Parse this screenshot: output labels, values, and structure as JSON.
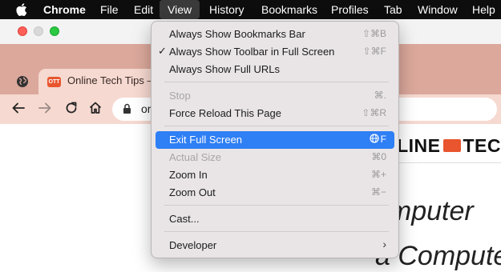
{
  "menubar": {
    "app_name": "Chrome",
    "items": [
      "File",
      "Edit",
      "View",
      "History",
      "Bookmarks",
      "Profiles",
      "Tab",
      "Window",
      "Help"
    ]
  },
  "browser": {
    "tab_title": "Online Tech Tips –",
    "favicon_text": "OTT",
    "url_partial": "or"
  },
  "page": {
    "logo_left": "NLINE",
    "logo_right": "TEC",
    "headline1": "omputer",
    "headline2": "a Compute"
  },
  "view_menu": {
    "items": [
      {
        "label": "Always Show Bookmarks Bar",
        "shortcut": "⇧⌘B"
      },
      {
        "label": "Always Show Toolbar in Full Screen",
        "shortcut": "⇧⌘F",
        "checked": true
      },
      {
        "label": "Always Show Full URLs",
        "shortcut": ""
      },
      {
        "label": "Stop",
        "shortcut": "⌘.",
        "disabled": true
      },
      {
        "label": "Force Reload This Page",
        "shortcut": "⇧⌘R"
      },
      {
        "label": "Exit Full Screen",
        "shortcut": "F",
        "highlighted": true
      },
      {
        "label": "Actual Size",
        "shortcut": "⌘0",
        "disabled": true
      },
      {
        "label": "Zoom In",
        "shortcut": "⌘+"
      },
      {
        "label": "Zoom Out",
        "shortcut": "⌘−"
      },
      {
        "label": "Cast...",
        "shortcut": ""
      },
      {
        "label": "Developer",
        "shortcut": ""
      }
    ]
  },
  "colors": {
    "menu_highlight": "#2f7ff5",
    "tab_strip": "#dba89b",
    "toolbar": "#f6d9d0",
    "brand_orange": "#e8552e"
  }
}
